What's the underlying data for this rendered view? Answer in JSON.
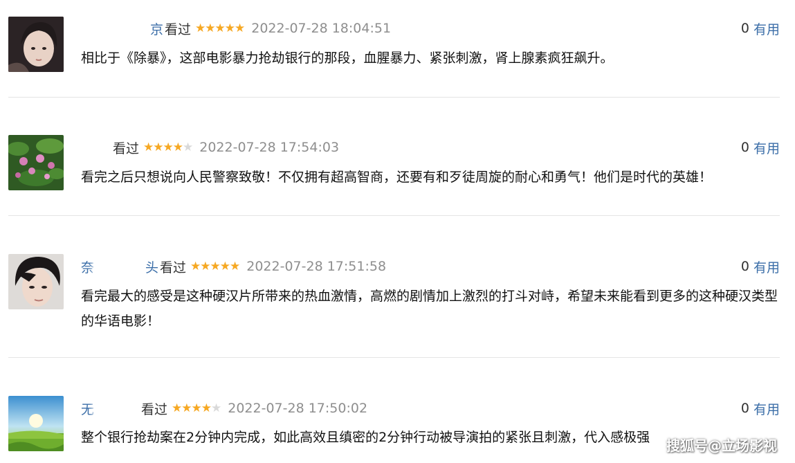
{
  "comments": [
    {
      "user_prefix": "",
      "user_suffix": "京",
      "watched": "看过",
      "stars": 5,
      "time": "2022-07-28 18:04:51",
      "useful_count": "0",
      "useful_label": "有用",
      "text": "相比于《除暴》，这部电影暴力抢劫银行的那段，血腥暴力、紧张刺激，肾上腺素疯狂飙升。"
    },
    {
      "user_prefix": "",
      "user_suffix": "",
      "watched": "看过",
      "stars": 4,
      "time": "2022-07-28 17:54:03",
      "useful_count": "0",
      "useful_label": "有用",
      "text": "看完之后只想说向人民警察致敬！不仅拥有超高智商，还要有和歹徒周旋的耐心和勇气！他们是时代的英雄！"
    },
    {
      "user_prefix": "奈",
      "user_suffix": "头",
      "watched": "看过",
      "stars": 5,
      "time": "2022-07-28 17:51:58",
      "useful_count": "0",
      "useful_label": "有用",
      "text": "看完最大的感受是这种硬汉片所带来的热血激情，高燃的剧情加上激烈的打斗对峙，希望未来能看到更多的这种硬汉类型的华语电影！"
    },
    {
      "user_prefix": "无",
      "user_suffix": "",
      "watched": "看过",
      "stars": 4,
      "time": "2022-07-28 17:50:02",
      "useful_count": "0",
      "useful_label": "有用",
      "text": "整个银行抢劫案在2分钟内完成，如此高效且缜密的2分钟行动被导演拍的紧张且刺激，代入感极强"
    }
  ],
  "watermark": "搜狐号@立场影视",
  "colors": {
    "username": "#3b6ea8",
    "star_on": "#f6a823",
    "star_off": "#d9d9d9",
    "time": "#8e8e8e",
    "divider": "#e4e4e4"
  }
}
